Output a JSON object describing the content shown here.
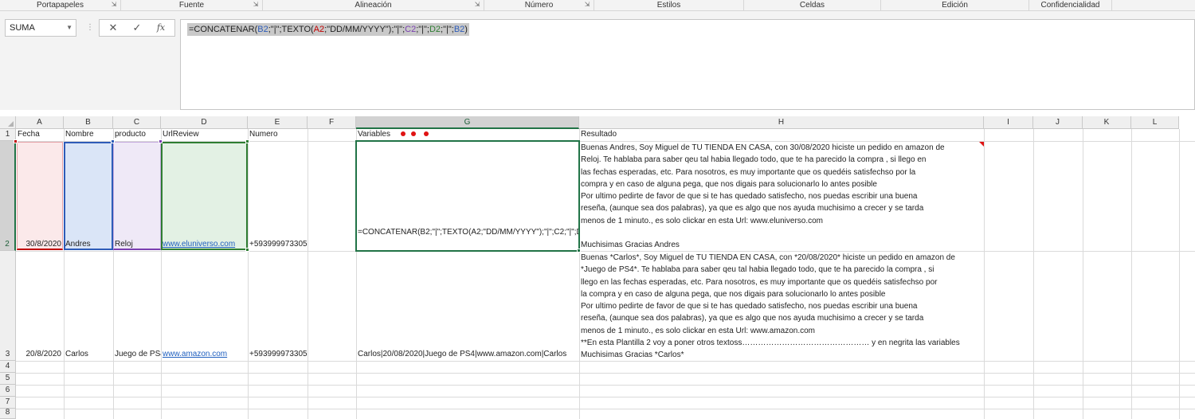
{
  "ribbon": {
    "groups": [
      "Portapapeles",
      "Fuente",
      "Alineación",
      "Número",
      "Estilos",
      "Celdas",
      "Edición",
      "Confidencialidad"
    ]
  },
  "formula_bar": {
    "name_box": "SUMA",
    "cancel_symbol": "✕",
    "enter_symbol": "✓",
    "fx_symbol": "fx",
    "formula_parts": [
      "=CONCATENAR(",
      "B2",
      ";\"|\";TEXTO(",
      "A2",
      ";\"DD/MM/YYYY\");\"|\";",
      "C2",
      ";\"|\";",
      "D2",
      ";\"|\";",
      "B2",
      ")"
    ]
  },
  "sheet": {
    "columns": [
      "A",
      "B",
      "C",
      "D",
      "E",
      "F",
      "G",
      "H",
      "I",
      "J",
      "K",
      "L"
    ],
    "rows": [
      "1",
      "2",
      "3",
      "4",
      "5",
      "6",
      "7",
      "8"
    ],
    "headers": {
      "a": "Fecha",
      "b": "Nombre",
      "c": "producto",
      "d": "UrlReview",
      "e": "Numero",
      "g": "Variables",
      "h": "Resultado"
    },
    "row2": {
      "a": "30/8/2020",
      "b": "Andres",
      "c": "Reloj",
      "d": "www.eluniverso.com",
      "e": "+593999973305",
      "g": "=CONCATENAR(B2;\"|\";TEXTO(A2;\"DD/MM/YYYY\");\"|\";C2;\"|\";D2;\"|\";B2)",
      "h": [
        "Buenas Andres, Soy Miguel de TU TIENDA EN CASA, con 30/08/2020  hiciste un pedido en amazon de",
        "Reloj. Te hablaba para saber qeu tal habia llegado todo, que te ha parecido la compra , si llego en",
        "las fechas esperadas, etc. Para nosotros, es muy importante que os quedéis satisfechso por la",
        "compra y en caso de alguna pega, que nos digais para solucionarlo lo antes posible",
        "Por ultimo pedirte de favor de que si te has quedado satisfecho, nos puedas escribir una buena",
        "reseña, (aunque sea dos palabras), ya que es algo que nos ayuda muchisimo a crecer y se tarda",
        "menos de 1 minuto., es solo clickar en esta Url: www.eluniverso.com",
        "",
        "Muchisimas Gracias Andres"
      ]
    },
    "row3": {
      "a": "20/8/2020",
      "b": "Carlos",
      "c": "Juego de PS4",
      "d": "www.amazon.com",
      "e": "+593999973305",
      "g": "Carlos|20/08/2020|Juego de PS4|www.amazon.com|Carlos",
      "h": [
        "Buenas *Carlos*, Soy Miguel de TU TIENDA EN CASA, con *20/08/2020*  hiciste un pedido en amazon de",
        "*Juego de PS4*. Te hablaba para saber qeu tal habia llegado todo, que te ha parecido la compra , si",
        "llego en las fechas esperadas, etc. Para nosotros, es muy importante que os quedéis satisfechso por",
        "la compra y en caso de alguna pega, que nos digais para solucionarlo lo antes posible",
        "Por ultimo pedirte de favor de que si te has quedado satisfecho, nos puedas escribir una buena",
        "reseña, (aunque sea dos palabras), ya que es algo que nos ayuda muchisimo a crecer y se tarda",
        "menos de 1 minuto., es solo clickar en esta Url: www.amazon.com",
        "**En esta Plantilla 2  voy a poner otros textoss………………………………………… y en negrita las variables",
        "Muchisimas Gracias *Carlos*"
      ]
    }
  },
  "colors": {
    "excel_green": "#217346",
    "ref_blue": "#2e5cb8",
    "ref_red": "#c00000",
    "ref_purple": "#7a3fb0",
    "ref_green": "#2f7d32",
    "annotation_red": "#e01313"
  }
}
